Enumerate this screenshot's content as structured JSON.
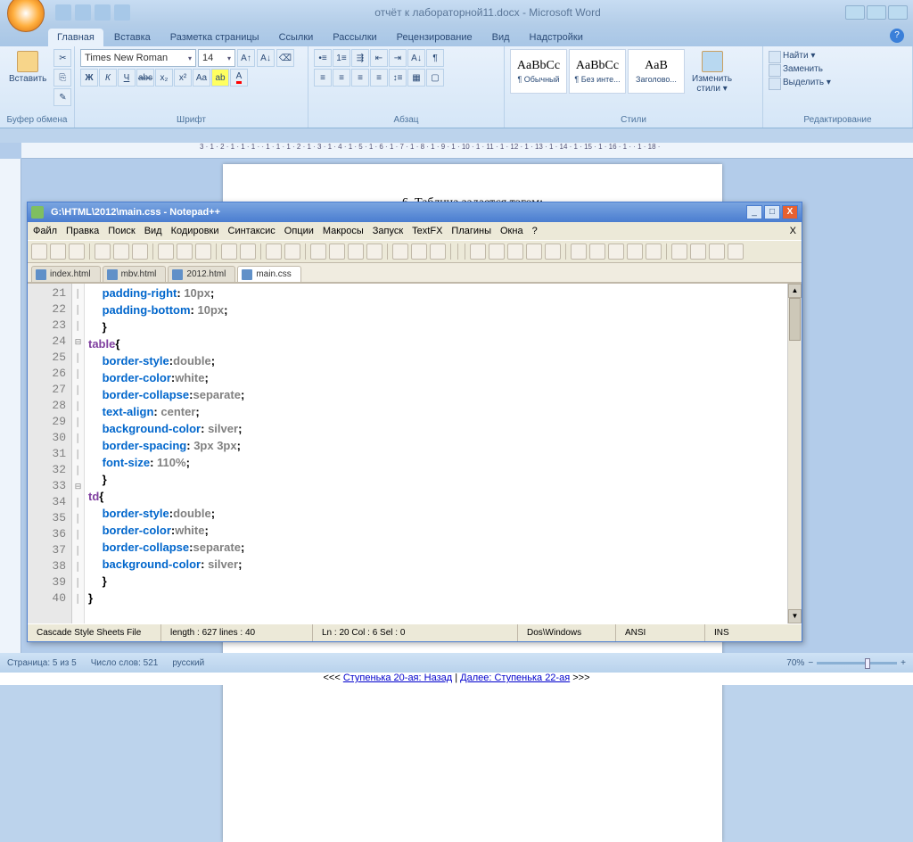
{
  "word": {
    "title": "отчёт к лабораторной11.docx - Microsoft Word",
    "tabs": [
      "Главная",
      "Вставка",
      "Разметка страницы",
      "Ссылки",
      "Рассылки",
      "Рецензирование",
      "Вид",
      "Надстройки"
    ],
    "groups": {
      "clipboard": "Буфер обмена",
      "paste": "Вставить",
      "font": "Шрифт",
      "font_name": "Times New Roman",
      "font_size": "14",
      "paragraph": "Абзац",
      "styles": "Стили",
      "style_items": [
        {
          "prev": "AaBbCc",
          "label": "¶ Обычный"
        },
        {
          "prev": "AaBbCc",
          "label": "¶ Без инте..."
        },
        {
          "prev": "AaB",
          "label": "Заголово..."
        }
      ],
      "change_styles": "Изменить\nстили ▾",
      "editing": "Редактирование",
      "find": "Найти ▾",
      "replace": "Заменить",
      "select": "Выделить ▾"
    },
    "ruler": "3 · 1 · 2 · 1 · 1 · 1 ·  · 1 · 1 · 1 · 2 · 1 · 3 · 1 · 4 · 1 · 5 · 1 · 6 · 1 · 7 · 1 · 8 · 1 · 9 · 1 · 10 · 1 · 11 · 1 · 12 · 1 · 13 · 1 · 14 · 1 · 15 · 1 · 16 · 1 ·  · 1 · 18 ·",
    "page_text": "6.  Таблица задается тэгом:",
    "status": {
      "page": "Страница: 5 из 5",
      "words": "Число слов: 521",
      "lang": "русский",
      "zoom": "70%"
    }
  },
  "nav": {
    "back": "Ступенька 20-ая: Назад",
    "fwd": "Далее: Ступенька 22-ая"
  },
  "npp": {
    "title": "G:\\HTML\\2012\\main.css - Notepad++",
    "menu": [
      "Файл",
      "Правка",
      "Поиск",
      "Вид",
      "Кодировки",
      "Синтаксис",
      "Опции",
      "Макросы",
      "Запуск",
      "TextFX",
      "Плагины",
      "Окна",
      "?"
    ],
    "close_menu": "X",
    "tabs": [
      "index.html",
      "mbv.html",
      "2012.html",
      "main.css"
    ],
    "active_tab": 3,
    "line_start": 21,
    "code": [
      {
        "indent": 1,
        "t": [
          [
            "kw",
            "padding-right"
          ],
          [
            "pun",
            ": "
          ],
          [
            "val",
            "10px"
          ],
          [
            "pun",
            ";"
          ]
        ]
      },
      {
        "indent": 1,
        "t": [
          [
            "kw",
            "padding-bottom"
          ],
          [
            "pun",
            ": "
          ],
          [
            "val",
            "10px"
          ],
          [
            "pun",
            ";"
          ]
        ]
      },
      {
        "indent": 1,
        "t": [
          [
            "pun",
            "}"
          ]
        ]
      },
      {
        "indent": 0,
        "fold": "⊟",
        "t": [
          [
            "sel",
            "table"
          ],
          [
            "pun",
            "{"
          ]
        ]
      },
      {
        "indent": 1,
        "t": [
          [
            "kw",
            "border-style"
          ],
          [
            "pun",
            ":"
          ],
          [
            "val",
            "double"
          ],
          [
            "pun",
            ";"
          ]
        ]
      },
      {
        "indent": 1,
        "t": [
          [
            "kw",
            "border-color"
          ],
          [
            "pun",
            ":"
          ],
          [
            "val",
            "white"
          ],
          [
            "pun",
            ";"
          ]
        ]
      },
      {
        "indent": 1,
        "t": [
          [
            "kw",
            "border-collapse"
          ],
          [
            "pun",
            ":"
          ],
          [
            "val",
            "separate"
          ],
          [
            "pun",
            ";"
          ]
        ]
      },
      {
        "indent": 1,
        "t": [
          [
            "kw",
            "text-align"
          ],
          [
            "pun",
            ": "
          ],
          [
            "val",
            "center"
          ],
          [
            "pun",
            ";"
          ]
        ]
      },
      {
        "indent": 1,
        "t": [
          [
            "kw",
            "background-color"
          ],
          [
            "pun",
            ": "
          ],
          [
            "val",
            "silver"
          ],
          [
            "pun",
            ";"
          ]
        ]
      },
      {
        "indent": 1,
        "t": [
          [
            "kw",
            "border-spacing"
          ],
          [
            "pun",
            ": "
          ],
          [
            "val",
            "3px 3px"
          ],
          [
            "pun",
            ";"
          ]
        ]
      },
      {
        "indent": 1,
        "t": [
          [
            "kw",
            "font-size"
          ],
          [
            "pun",
            ": "
          ],
          [
            "val",
            "110%"
          ],
          [
            "pun",
            ";"
          ]
        ]
      },
      {
        "indent": 1,
        "t": [
          [
            "pun",
            "}"
          ]
        ]
      },
      {
        "indent": 0,
        "fold": "⊟",
        "t": [
          [
            "sel",
            "td"
          ],
          [
            "pun",
            "{"
          ]
        ]
      },
      {
        "indent": 1,
        "t": [
          [
            "kw",
            "border-style"
          ],
          [
            "pun",
            ":"
          ],
          [
            "val",
            "double"
          ],
          [
            "pun",
            ";"
          ]
        ]
      },
      {
        "indent": 1,
        "t": [
          [
            "kw",
            "border-color"
          ],
          [
            "pun",
            ":"
          ],
          [
            "val",
            "white"
          ],
          [
            "pun",
            ";"
          ]
        ]
      },
      {
        "indent": 1,
        "t": [
          [
            "kw",
            "border-collapse"
          ],
          [
            "pun",
            ":"
          ],
          [
            "val",
            "separate"
          ],
          [
            "pun",
            ";"
          ]
        ]
      },
      {
        "indent": 1,
        "t": [
          [
            "kw",
            "background-color"
          ],
          [
            "pun",
            ": "
          ],
          [
            "val",
            "silver"
          ],
          [
            "pun",
            ";"
          ]
        ]
      },
      {
        "indent": 1,
        "t": [
          [
            "pun",
            "}"
          ]
        ]
      },
      {
        "indent": 0,
        "t": [
          [
            "pun",
            "}"
          ]
        ]
      },
      {
        "indent": 0,
        "t": []
      }
    ],
    "status": {
      "type": "Cascade Style Sheets File",
      "length": "length : 627    lines : 40",
      "pos": "Ln : 20    Col : 6    Sel : 0",
      "eol": "Dos\\Windows",
      "enc": "ANSI",
      "mode": "INS"
    }
  }
}
